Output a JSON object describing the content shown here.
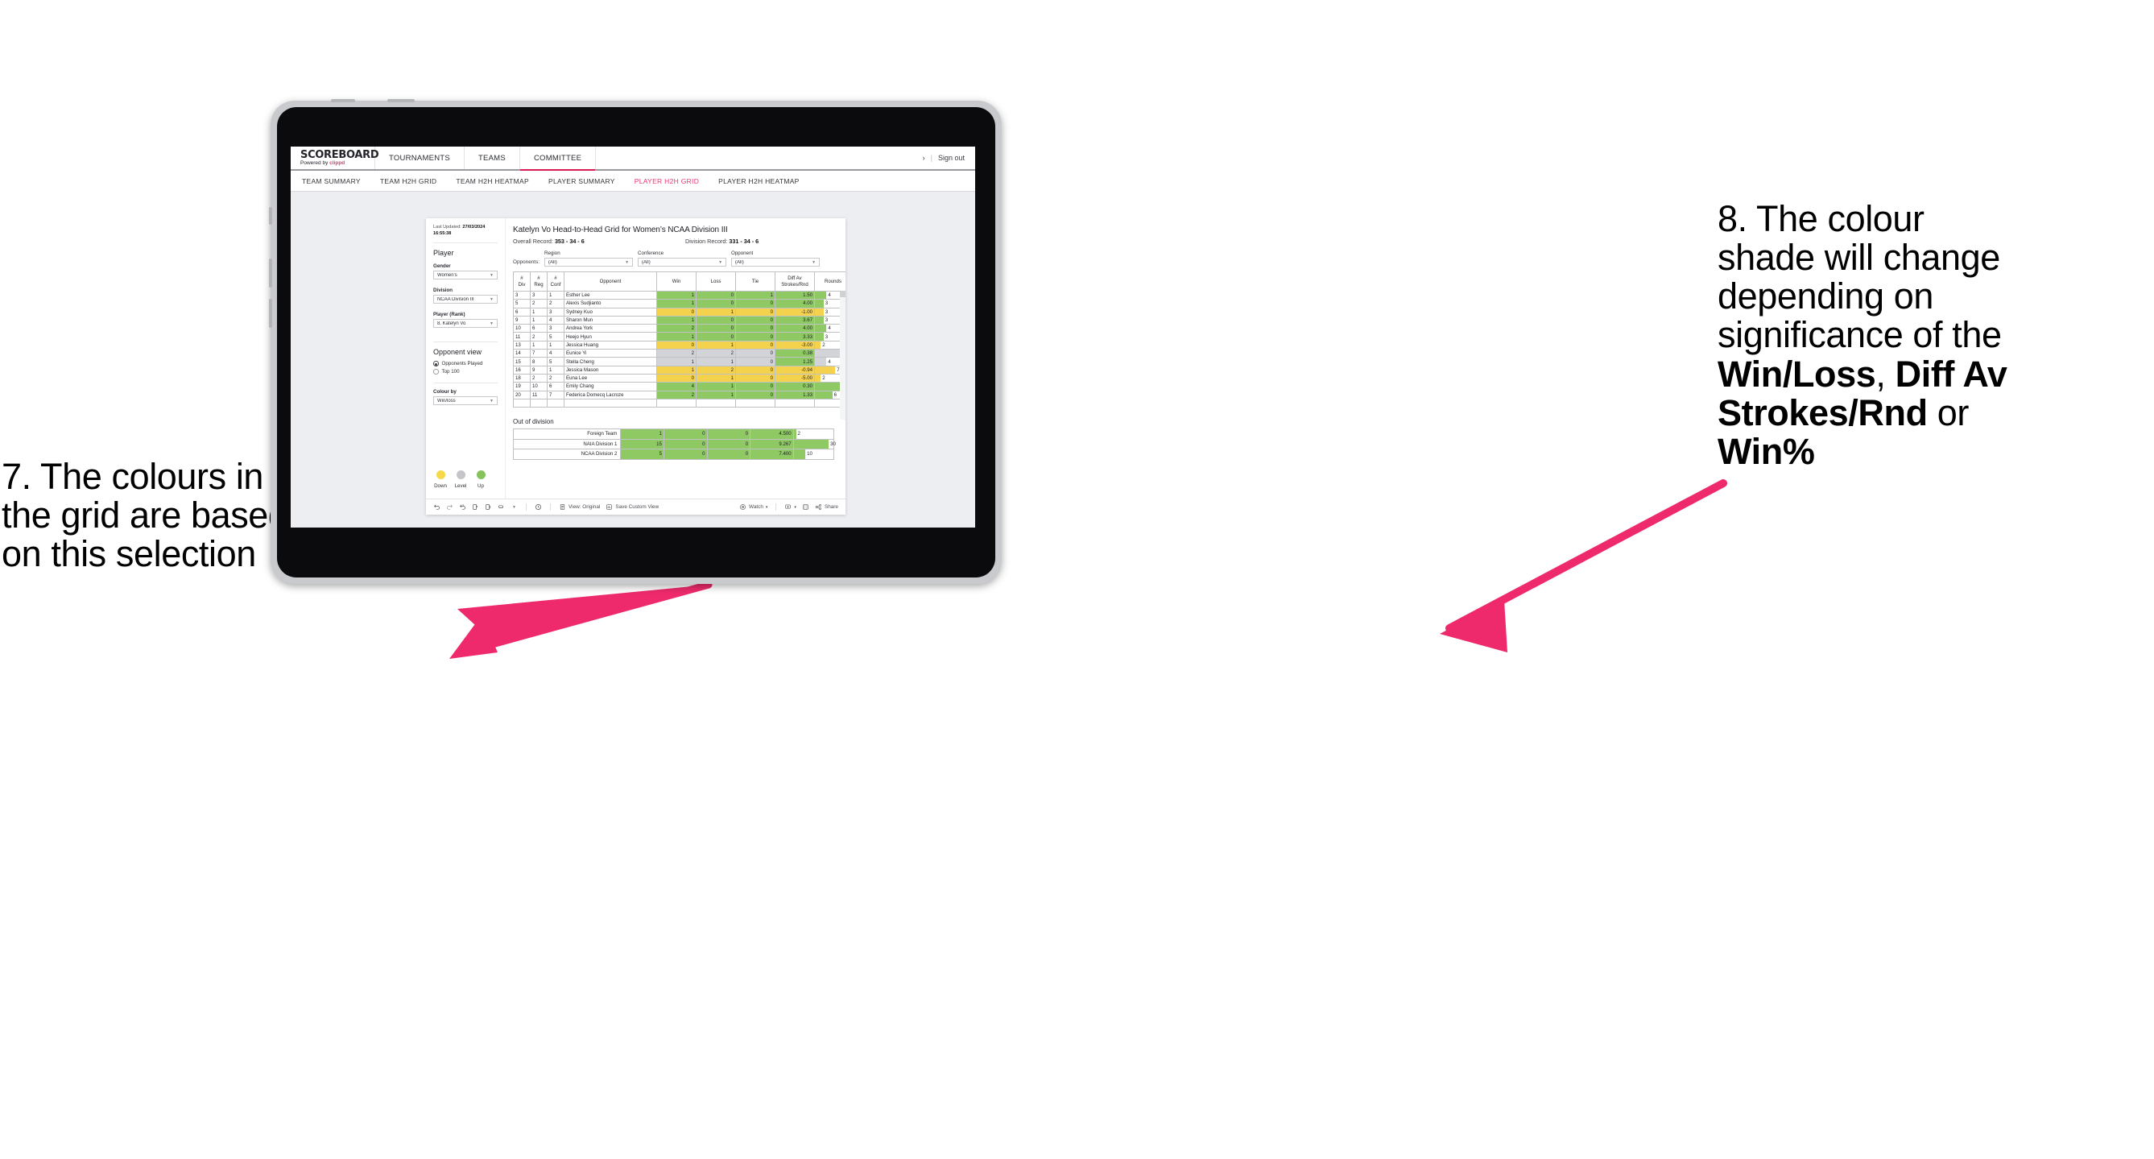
{
  "annotations": {
    "left": {
      "line1": "7. The colours in",
      "line2": "the grid are based",
      "line3": "on this selection"
    },
    "right": {
      "l1": "8. The colour",
      "l2": "shade will change",
      "l3": "depending on",
      "l4": "significance of the",
      "b1": "Win/Loss",
      "c1": ", ",
      "b2": "Diff Av",
      "b3": "Strokes/Rnd",
      "l5": " or",
      "b4": "Win%"
    },
    "arrow_color": "#ee2a6c"
  },
  "app": {
    "brand": {
      "name": "SCOREBOARD",
      "tagline_pre": "Powered by ",
      "tagline_brand": "clippd"
    },
    "top_nav": [
      {
        "label": "TOURNAMENTS",
        "active": false
      },
      {
        "label": "TEAMS",
        "active": false
      },
      {
        "label": "COMMITTEE",
        "active": true
      }
    ],
    "top_right": {
      "chevron": "›",
      "divider": "|",
      "sign_out": "Sign out"
    },
    "sub_nav": [
      {
        "label": "TEAM SUMMARY",
        "active": false
      },
      {
        "label": "TEAM H2H GRID",
        "active": false
      },
      {
        "label": "TEAM H2H HEATMAP",
        "active": false
      },
      {
        "label": "PLAYER SUMMARY",
        "active": false
      },
      {
        "label": "PLAYER H2H GRID",
        "active": true
      },
      {
        "label": "PLAYER H2H HEATMAP",
        "active": false
      }
    ],
    "accent": "#e8366f"
  },
  "sidebar": {
    "last_updated_label": "Last Updated: ",
    "last_updated_value": "27/03/2024",
    "last_updated_time": "16:55:38",
    "player_section": "Player",
    "fields": [
      {
        "label": "Gender",
        "value": "Women’s"
      },
      {
        "label": "Division",
        "value": "NCAA Division III"
      },
      {
        "label": "Player (Rank)",
        "value": "8. Katelyn Vo"
      }
    ],
    "opponent_view": {
      "title": "Opponent view",
      "options": [
        {
          "label": "Opponents Played",
          "selected": true
        },
        {
          "label": "Top 100",
          "selected": false
        }
      ]
    },
    "colour_by": {
      "label": "Colour by",
      "value": "Win/loss"
    },
    "legend": {
      "items": [
        {
          "label": "Down",
          "color": "#f5d949"
        },
        {
          "label": "Level",
          "color": "#c3c5c9"
        },
        {
          "label": "Up",
          "color": "#86c35c"
        }
      ]
    }
  },
  "viz": {
    "title": "Katelyn Vo Head-to-Head Grid for Women’s NCAA Division III",
    "overall_record_label": "Overall Record: ",
    "overall_record_value": "353 -  34 - 6",
    "division_record_label": "Division Record: ",
    "division_record_value": "331 -  34 - 6",
    "opponents_label": "Opponents:",
    "opponent_filters": [
      {
        "label": "Region",
        "value": "(All)"
      },
      {
        "label": "Conference",
        "value": "(All)"
      },
      {
        "label": "Opponent",
        "value": "(All)"
      }
    ],
    "out_of_division_title": "Out of division"
  },
  "chart_data": {
    "type": "table",
    "title": "Katelyn Vo Head-to-Head Grid for Women’s NCAA Division III",
    "columns": [
      "# Div",
      "# Reg",
      "# Conf",
      "Opponent",
      "Win",
      "Loss",
      "Tie",
      "Diff Av Strokes/Rnd",
      "Rounds"
    ],
    "column_headers_multiline": [
      {
        "l1": "#",
        "l2": "Div"
      },
      {
        "l1": "#",
        "l2": "Reg"
      },
      {
        "l1": "#",
        "l2": "Conf"
      },
      {
        "l1": "Opponent",
        "l2": ""
      },
      {
        "l1": "Win",
        "l2": ""
      },
      {
        "l1": "Loss",
        "l2": ""
      },
      {
        "l1": "Tie",
        "l2": ""
      },
      {
        "l1": "Diff Av",
        "l2": "Strokes/Rnd"
      },
      {
        "l1": "Rounds",
        "l2": ""
      }
    ],
    "rounds_max": 11,
    "colors": {
      "up": "#8fc963",
      "down": "#f5d24e",
      "level": "#d2d4d7"
    },
    "rows": [
      {
        "div": "3",
        "reg": "3",
        "conf": "1",
        "opponent": "Esther Lee",
        "win": "1",
        "loss": "0",
        "tie": "1",
        "diff": "1.50",
        "rounds": 4,
        "state": "up",
        "diff_state": "up"
      },
      {
        "div": "5",
        "reg": "2",
        "conf": "2",
        "opponent": "Alexis Sudjianto",
        "win": "1",
        "loss": "0",
        "tie": "0",
        "diff": "4.00",
        "rounds": 3,
        "state": "up",
        "diff_state": "up"
      },
      {
        "div": "6",
        "reg": "1",
        "conf": "3",
        "opponent": "Sydney Kuo",
        "win": "0",
        "loss": "1",
        "tie": "0",
        "diff": "-1.00",
        "rounds": 3,
        "state": "down",
        "diff_state": "down"
      },
      {
        "div": "9",
        "reg": "1",
        "conf": "4",
        "opponent": "Sharon Mun",
        "win": "1",
        "loss": "0",
        "tie": "0",
        "diff": "3.67",
        "rounds": 3,
        "state": "up",
        "diff_state": "up"
      },
      {
        "div": "10",
        "reg": "6",
        "conf": "3",
        "opponent": "Andrea York",
        "win": "2",
        "loss": "0",
        "tie": "0",
        "diff": "4.00",
        "rounds": 4,
        "state": "up",
        "diff_state": "up"
      },
      {
        "div": "11",
        "reg": "2",
        "conf": "5",
        "opponent": "Heejo Hyun",
        "win": "1",
        "loss": "0",
        "tie": "0",
        "diff": "3.33",
        "rounds": 3,
        "state": "up",
        "diff_state": "up"
      },
      {
        "div": "13",
        "reg": "1",
        "conf": "1",
        "opponent": "Jessica Huang",
        "win": "0",
        "loss": "1",
        "tie": "0",
        "diff": "-3.00",
        "rounds": 2,
        "state": "down",
        "diff_state": "down"
      },
      {
        "div": "14",
        "reg": "7",
        "conf": "4",
        "opponent": "Eunice Yi",
        "win": "2",
        "loss": "2",
        "tie": "0",
        "diff": "0.38",
        "rounds": 9,
        "state": "level",
        "diff_state": "up"
      },
      {
        "div": "15",
        "reg": "8",
        "conf": "5",
        "opponent": "Stella Cheng",
        "win": "1",
        "loss": "1",
        "tie": "0",
        "diff": "1.25",
        "rounds": 4,
        "state": "level",
        "diff_state": "up"
      },
      {
        "div": "16",
        "reg": "9",
        "conf": "1",
        "opponent": "Jessica Mason",
        "win": "1",
        "loss": "2",
        "tie": "0",
        "diff": "-0.94",
        "rounds": 7,
        "state": "down",
        "diff_state": "down"
      },
      {
        "div": "18",
        "reg": "2",
        "conf": "2",
        "opponent": "Euna Lee",
        "win": "0",
        "loss": "1",
        "tie": "0",
        "diff": "-5.00",
        "rounds": 2,
        "state": "down",
        "diff_state": "down"
      },
      {
        "div": "19",
        "reg": "10",
        "conf": "6",
        "opponent": "Emily Chang",
        "win": "4",
        "loss": "1",
        "tie": "0",
        "diff": "0.30",
        "rounds": 11,
        "state": "up",
        "diff_state": "up"
      },
      {
        "div": "20",
        "reg": "11",
        "conf": "7",
        "opponent": "Federica Domecq Lacroze",
        "win": "2",
        "loss": "1",
        "tie": "0",
        "diff": "1.33",
        "rounds": 6,
        "state": "up",
        "diff_state": "up"
      }
    ],
    "out_of_division": {
      "rounds_max": 30,
      "rows": [
        {
          "name": "Foreign Team",
          "win": "1",
          "loss": "0",
          "tie": "0",
          "diff": "4.500",
          "rounds": 2,
          "state": "up"
        },
        {
          "name": "NAIA Division 1",
          "win": "15",
          "loss": "0",
          "tie": "0",
          "diff": "9.267",
          "rounds": 30,
          "state": "up"
        },
        {
          "name": "NCAA Division 2",
          "win": "5",
          "loss": "0",
          "tie": "0",
          "diff": "7.400",
          "rounds": 10,
          "state": "up"
        }
      ]
    }
  },
  "toolbar": {
    "view_original": "View: Original",
    "save_custom_view": "Save Custom View",
    "watch": "Watch",
    "share": "Share",
    "caret": "▾"
  }
}
